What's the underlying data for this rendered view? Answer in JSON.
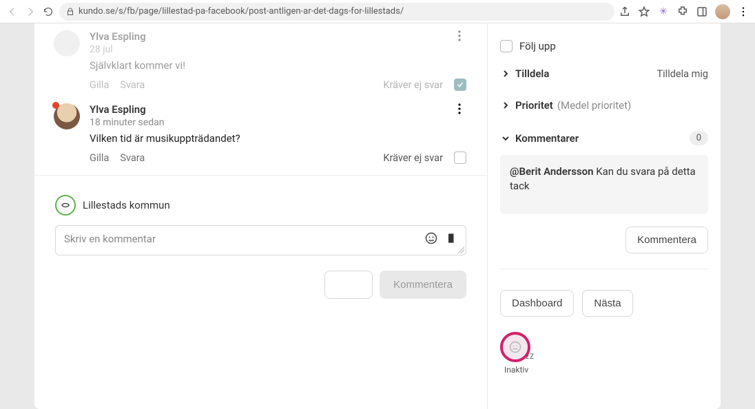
{
  "browser": {
    "url": "kundo.se/s/fb/page/lillestad-pa-facebook/post-antligen-ar-det-dags-for-lillestads/"
  },
  "comments": [
    {
      "name": "Ylva Espling",
      "time": "28 jul",
      "text": "Självklart kommer vi!",
      "like": "Gilla",
      "reply": "Svara",
      "noReply": "Kräver ej svar",
      "checked": true
    },
    {
      "name": "Ylva Espling",
      "time": "18 minuter sedan",
      "text": "Vilken tid är musikuppträdandet?",
      "like": "Gilla",
      "reply": "Svara",
      "noReply": "Kräver ej svar",
      "checked": false
    }
  ],
  "composer": {
    "org": "Lillestads kommun",
    "placeholder": "Skriv en kommentar",
    "submit": "Kommentera"
  },
  "sidebar": {
    "follow": "Följ upp",
    "assign": {
      "label": "Tilldela",
      "right": "Tilldela mig"
    },
    "priority": {
      "label": "Prioritet",
      "sub": "(Medel prioritet)"
    },
    "commentsSection": {
      "label": "Kommentarer",
      "count": "0"
    },
    "commentBox": {
      "mention": "@Berit Andersson",
      "text": " Kan du svara på detta tack"
    },
    "commentBtn": "Kommentera",
    "bottom": {
      "dashboard": "Dashboard",
      "next": "Nästa"
    },
    "inactive": "Inaktiv"
  }
}
